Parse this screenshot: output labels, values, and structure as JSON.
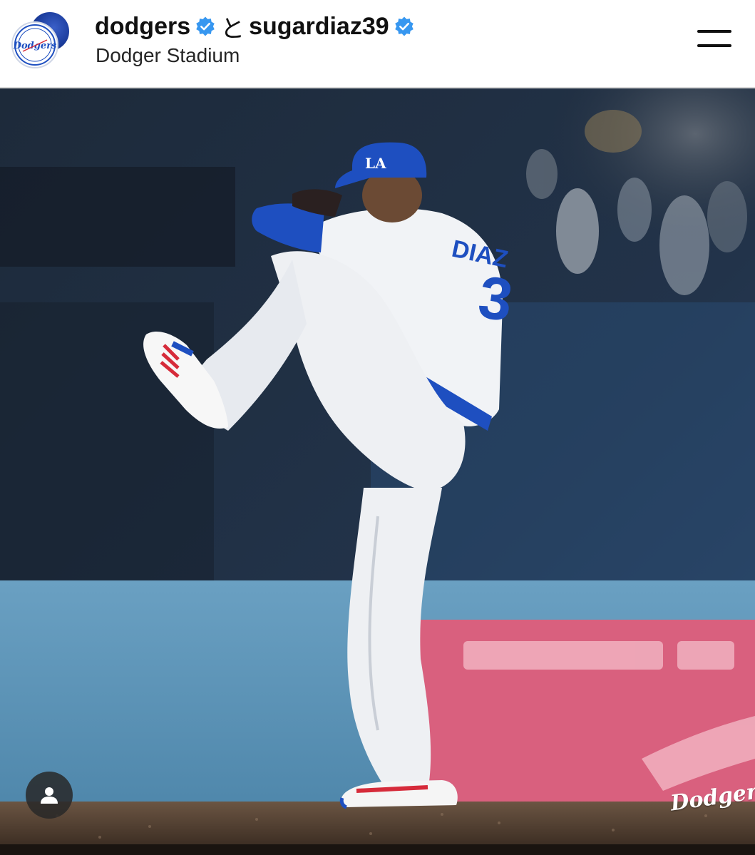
{
  "header": {
    "account_primary": "dodgers",
    "connector": "と",
    "account_secondary": "sugardiaz39",
    "location": "Dodger Stadium",
    "avatar_text": "Dodgers",
    "verified_color": "#3797f0"
  },
  "post": {
    "jersey_name": "DIAZ",
    "jersey_number": "3",
    "cap_logo": "LA",
    "watermark": "Dodgers",
    "tag_icon": "person-icon"
  },
  "colors": {
    "dodger_blue": "#1e4fc0",
    "field_wall": "#5e97b9",
    "pink_sign": "#d9607e",
    "dirt": "#5a4636"
  }
}
